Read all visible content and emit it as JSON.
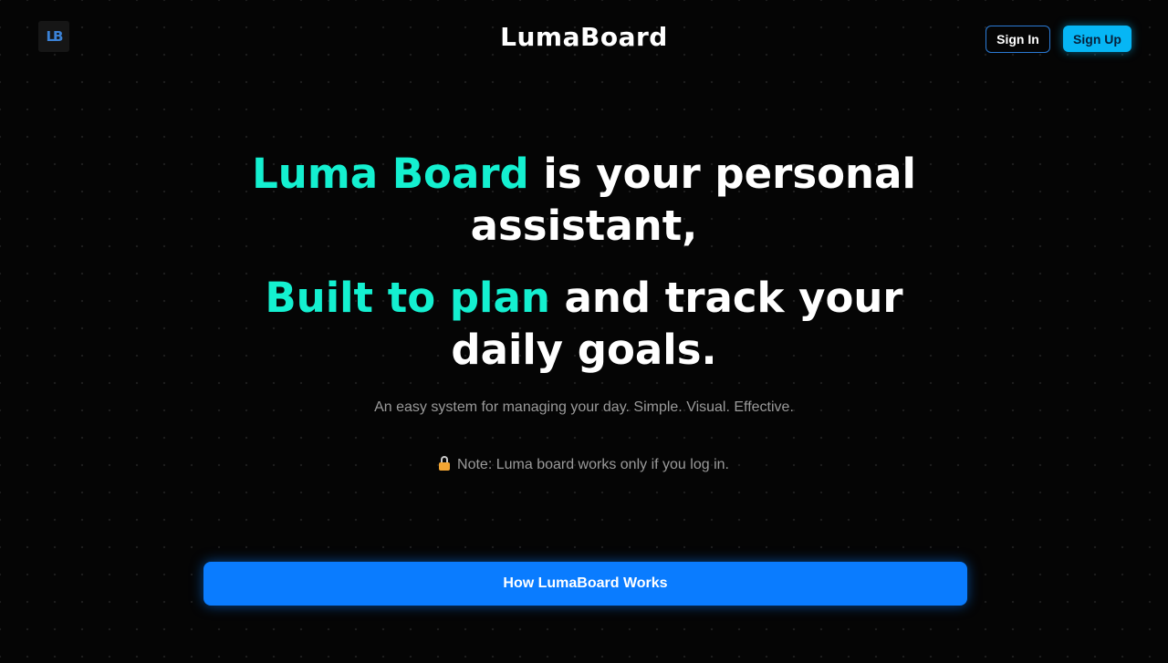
{
  "header": {
    "logo_text": "LB",
    "brand": "LumaBoard",
    "signin_label": "Sign In",
    "signup_label": "Sign Up"
  },
  "hero": {
    "line1_accent": "Luma Board",
    "line1_rest": " is your personal assistant,",
    "line2_accent": "Built to plan",
    "line2_rest": " and track your daily goals.",
    "subtitle": "An easy system for managing your day. Simple. Visual. Effective.",
    "note_icon": "lock-icon",
    "note": "Note: Luma board works only if you log in.",
    "cta_label": "How LumaBoard Works"
  },
  "colors": {
    "background": "#050505",
    "accent": "#14f0d0",
    "primary_button": "#0a7cff",
    "signup_button": "#06b6f5",
    "signin_border": "#2b7bd6"
  }
}
